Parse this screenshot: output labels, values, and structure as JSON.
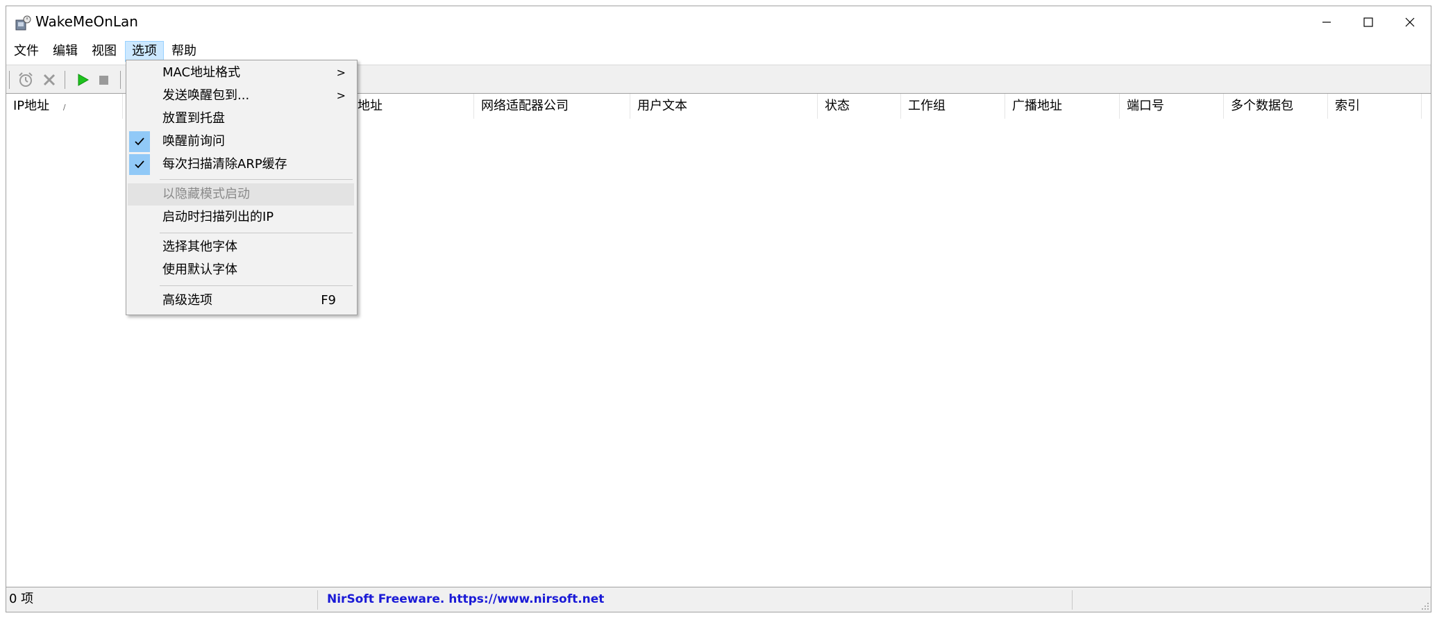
{
  "window": {
    "title": "WakeMeOnLan"
  },
  "menubar": {
    "items": [
      {
        "label": "文件"
      },
      {
        "label": "编辑"
      },
      {
        "label": "视图"
      },
      {
        "label": "选项"
      },
      {
        "label": "帮助"
      }
    ]
  },
  "toolbar": {
    "icons": [
      "alarm-icon",
      "delete-icon",
      "play-icon",
      "stop-icon"
    ]
  },
  "listview": {
    "columns": [
      {
        "label": "IP地址",
        "sort": "ascending"
      },
      {
        "label": "地址"
      },
      {
        "label": "网络适配器公司"
      },
      {
        "label": "用户文本"
      },
      {
        "label": "状态"
      },
      {
        "label": "工作组"
      },
      {
        "label": "广播地址"
      },
      {
        "label": "端口号"
      },
      {
        "label": "多个数据包"
      },
      {
        "label": "索引"
      }
    ]
  },
  "options_menu": {
    "items": [
      {
        "label": "MAC地址格式",
        "submenu": true
      },
      {
        "label": "发送唤醒包到...",
        "submenu": true
      },
      {
        "label": "放置到托盘"
      },
      {
        "label": "唤醒前询问",
        "checked": true
      },
      {
        "label": "每次扫描清除ARP缓存",
        "checked": true
      },
      {
        "label": "以隐藏模式启动",
        "disabled": true
      },
      {
        "label": "启动时扫描列出的IP"
      },
      {
        "label": "选择其他字体"
      },
      {
        "label": "使用默认字体"
      },
      {
        "label": "高级选项",
        "shortcut": "F9"
      }
    ],
    "submenu_arrow": ">"
  },
  "statusbar": {
    "count": "0 项",
    "link": "NirSoft Freeware. https://www.nirsoft.net"
  },
  "colors": {
    "menu_active_bg": "#cce8ff",
    "check_bg": "#91c9f7",
    "link": "#1a1ad6",
    "play_green": "#1ec21e"
  }
}
